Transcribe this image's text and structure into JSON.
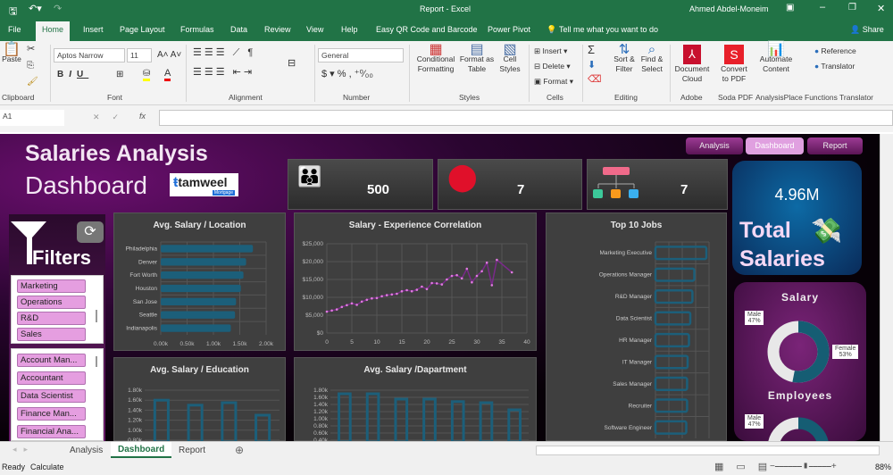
{
  "window": {
    "title": "Report - Excel",
    "user": "Ahmed Abdel-Moneim"
  },
  "menu": [
    "File",
    "Home",
    "Insert",
    "Page Layout",
    "Formulas",
    "Data",
    "Review",
    "View",
    "Help",
    "Easy QR Code and Barcode",
    "Power Pivot"
  ],
  "tell_me": "Tell me what you want to do",
  "share": "Share",
  "ribbon": {
    "paste": "Paste",
    "font_name": "Aptos Narrow",
    "font_size": "11",
    "number_format": "General",
    "conditional": [
      "Conditional",
      "Formatting"
    ],
    "format_table": [
      "Format as",
      "Table"
    ],
    "cell_styles": [
      "Cell",
      "Styles"
    ],
    "insert": "Insert",
    "delete": "Delete",
    "format": "Format",
    "sort": [
      "Sort &",
      "Filter"
    ],
    "find": [
      "Find &",
      "Select"
    ],
    "doc_cloud": [
      "Document",
      "Cloud"
    ],
    "convert": [
      "Convert",
      "to PDF"
    ],
    "automate": [
      "Automate",
      "Content"
    ],
    "reference": "Reference",
    "translator": "Translator",
    "groups": [
      "Clipboard",
      "Font",
      "Alignment",
      "Number",
      "Styles",
      "Cells",
      "Editing",
      "Adobe",
      "Soda PDF",
      "AnalysisPlace",
      "Functions Translator"
    ]
  },
  "formula_bar": {
    "name_box": "A1",
    "fx": "fx",
    "value": ""
  },
  "dashboard": {
    "title1": "Salaries Analysis",
    "title2": "Dashboard",
    "logo_text": "tamweel",
    "logo_sub": "Mortgage",
    "nav": [
      "Analysis",
      "Dashboard",
      "Report"
    ],
    "kpis": [
      {
        "icon": "people-icon",
        "value": "500"
      },
      {
        "icon": "location-pin-icon",
        "value": "7"
      },
      {
        "icon": "org-chart-icon",
        "value": "7"
      }
    ],
    "total": {
      "value": "4.96M",
      "label1": "Total",
      "label2": "Salaries"
    },
    "filters_label": "Filters",
    "slicer_departments": [
      "Marketing",
      "Operations",
      "R&D",
      "Sales"
    ],
    "slicer_jobs": [
      "Account Man...",
      "Accountant",
      "Data Scientist",
      "Finance Man...",
      "Financial Ana..."
    ],
    "gender": {
      "salary_title": "Salary",
      "employees_title": "Employees",
      "male": "Male",
      "male_pct": "47%",
      "female": "Female",
      "female_pct": "53%"
    }
  },
  "chart_data": [
    {
      "type": "bar",
      "orientation": "horizontal",
      "title": "Avg. Salary / Location",
      "categories": [
        "Philadelphia",
        "Denver",
        "Fort Worth",
        "Houston",
        "San Jose",
        "Seattle",
        "Indianapolis"
      ],
      "values": [
        1.75,
        1.62,
        1.57,
        1.52,
        1.43,
        1.41,
        1.33
      ],
      "xlim": [
        0,
        2
      ],
      "ticks": [
        "0.00k",
        "0.50k",
        "1.00k",
        "1.50k",
        "2.00k"
      ]
    },
    {
      "type": "line",
      "title": "Salary - Experience Correlation",
      "x": [
        0,
        1,
        2,
        3,
        4,
        5,
        6,
        7,
        8,
        9,
        10,
        11,
        12,
        13,
        14,
        15,
        16,
        17,
        18,
        19,
        20,
        21,
        22,
        23,
        24,
        25,
        26,
        27,
        28,
        29,
        30,
        31,
        32,
        33,
        34,
        37
      ],
      "y": [
        6000,
        6300,
        6600,
        7300,
        7800,
        8300,
        7900,
        8800,
        9300,
        9700,
        9800,
        10300,
        10600,
        10800,
        11000,
        11700,
        12000,
        11700,
        12100,
        13000,
        12300,
        14000,
        13900,
        13600,
        15000,
        16000,
        16200,
        15300,
        18000,
        14200,
        16000,
        17300,
        19700,
        13400,
        20500,
        17000
      ],
      "xlim": [
        0,
        40
      ],
      "ylim": [
        0,
        25000
      ],
      "xticks": [
        "0",
        "5",
        "10",
        "15",
        "20",
        "25",
        "30",
        "35",
        "40"
      ],
      "yticks": [
        "$0",
        "$5,000",
        "$10,000",
        "$15,000",
        "$20,000",
        "$25,000"
      ]
    },
    {
      "type": "bar",
      "orientation": "horizontal",
      "title": "Top 10 Jobs",
      "categories": [
        "Marketing Executive",
        "Operations Manager",
        "R&D Manager",
        "Data Scientist",
        "HR Manager",
        "IT Manager",
        "Sales Manager",
        "Recruiter",
        "Software Engineer"
      ],
      "values": [
        1.9,
        1.45,
        1.38,
        1.3,
        1.25,
        1.2,
        1.18,
        1.18,
        1.15
      ],
      "xlim": [
        0,
        2
      ]
    },
    {
      "type": "bar",
      "title": "Avg. Salary / Education",
      "values": [
        1.6,
        1.5,
        1.55,
        1.3
      ],
      "ylim": [
        0,
        1.8
      ],
      "yticks": [
        "0.80k",
        "1.00k",
        "1.20k",
        "1.40k",
        "1.60k",
        "1.80k"
      ]
    },
    {
      "type": "bar",
      "title": "Avg. Salary /Dapartment",
      "values": [
        1.7,
        1.7,
        1.55,
        1.55,
        1.48,
        1.45,
        1.25
      ],
      "ylim": [
        0,
        1.8
      ],
      "yticks": [
        "0.40k",
        "0.60k",
        "0.80k",
        "1.00k",
        "1.20k",
        "1.40k",
        "1.60k",
        "1.80k"
      ]
    },
    {
      "type": "pie",
      "title": "Salary",
      "series": [
        {
          "name": "Male",
          "value": 47
        },
        {
          "name": "Female",
          "value": 53
        }
      ]
    }
  ],
  "sheet_tabs": [
    "Analysis",
    "Dashboard",
    "Report"
  ],
  "active_tab": "Dashboard",
  "status": {
    "ready": "Ready",
    "calculate": "Calculate",
    "zoom": "88%"
  },
  "colors": {
    "excel_green": "#217346",
    "bar": "#1c5f7a",
    "slicer": "#e59ee0"
  }
}
